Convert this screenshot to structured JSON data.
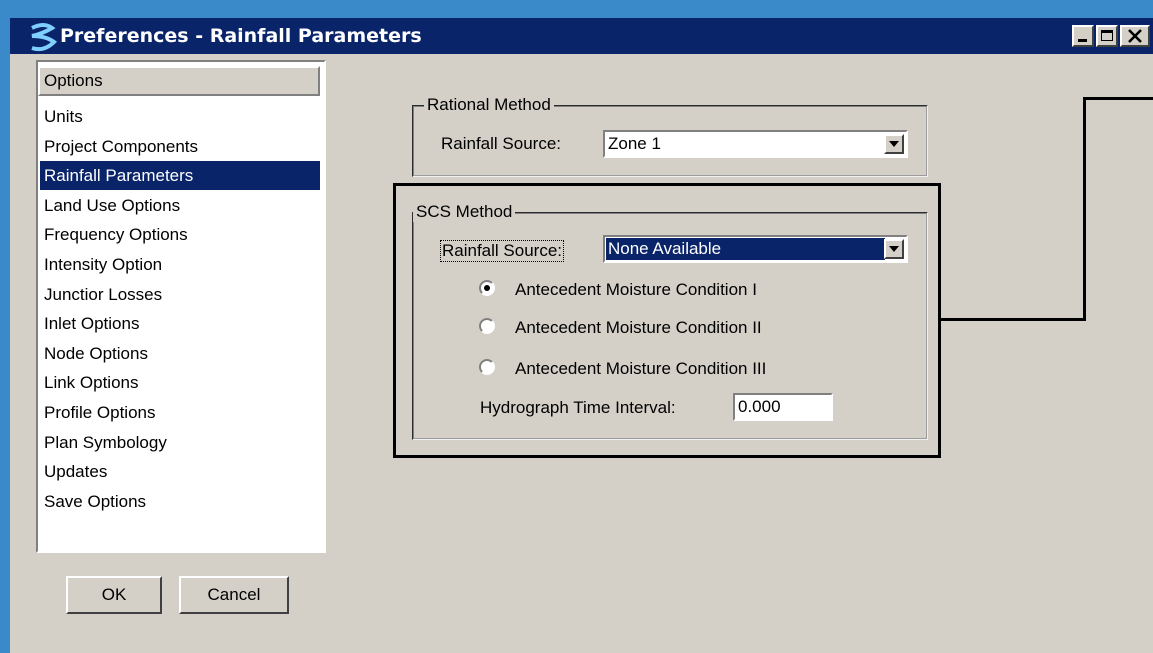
{
  "window": {
    "title": "Preferences - Rainfall Parameters",
    "title_bar_color": "#0a246a",
    "face_color": "#d4d0c8",
    "desktop_color": "#3a8ac9",
    "app_icon": "bentley-b-icon",
    "controls": [
      "minimize-icon",
      "maximize-icon",
      "close-icon"
    ]
  },
  "options": {
    "header": "Options",
    "items": [
      "Units",
      "Project Components",
      "Rainfall Parameters",
      "Land Use Options",
      "Frequency Options",
      "Intensity Option",
      "Junctior Losses",
      "Inlet Options",
      "Node Options",
      "Link Options",
      "Profile Options",
      "Plan Symbology",
      "Updates",
      "Save Options"
    ],
    "selected": "Rainfall Parameters"
  },
  "buttons": {
    "ok": "OK",
    "cancel": "Cancel"
  },
  "rational": {
    "group_label": "Rational Method",
    "source_label": "Rainfall Source:",
    "source_value": "Zone 1"
  },
  "scs": {
    "group_label": "SCS Method",
    "source_label": "Rainfall Source:",
    "source_value": "None Available",
    "amc": [
      {
        "label": "Antecedent Moisture Condition I",
        "selected": true
      },
      {
        "label": "Antecedent Moisture Condition II",
        "selected": false
      },
      {
        "label": "Antecedent Moisture Condition III",
        "selected": false
      }
    ],
    "interval_label": "Hydrograph Time Interval:",
    "interval_value": "0.000"
  }
}
